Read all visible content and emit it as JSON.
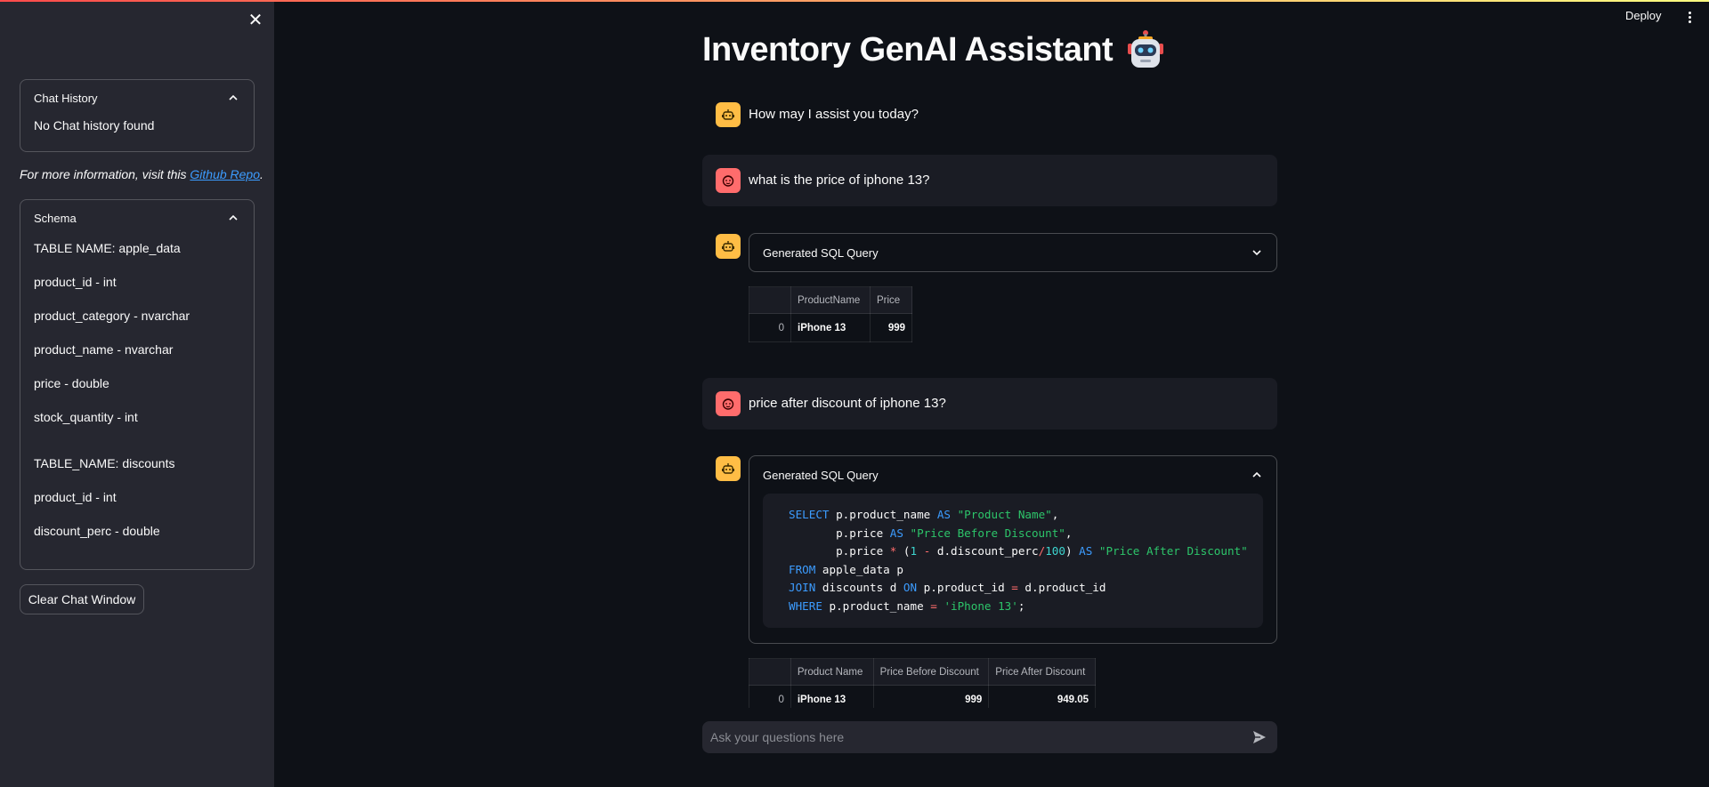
{
  "app": {
    "title": "Inventory GenAI Assistant"
  },
  "header": {
    "deploy_label": "Deploy"
  },
  "sidebar": {
    "chat_history": {
      "title": "Chat History",
      "empty_text": "No Chat history found"
    },
    "info": {
      "prefix": "For more information, visit this ",
      "link_text": "Github Repo",
      "suffix": "."
    },
    "schema": {
      "title": "Schema",
      "lines_a": [
        "TABLE NAME: apple_data",
        "product_id - int",
        "product_category - nvarchar",
        "product_name - nvarchar",
        "price - double",
        "stock_quantity - int"
      ],
      "lines_b": [
        "TABLE_NAME: discounts",
        "product_id - int",
        "discount_perc - double"
      ]
    },
    "clear_button": "Clear Chat Window"
  },
  "messages": {
    "greeting": "How may I assist you today?",
    "q1": "what is the price of iphone 13?",
    "q2": "price after discount of iphone 13?",
    "sql_expander_label": "Generated SQL Query"
  },
  "table1": {
    "columns": [
      "",
      "ProductName",
      "Price"
    ],
    "rows": [
      [
        "0",
        "iPhone 13",
        "999"
      ]
    ]
  },
  "table2": {
    "columns": [
      "",
      "Product Name",
      "Price Before Discount",
      "Price After Discount"
    ],
    "rows": [
      [
        "0",
        "iPhone 13",
        "999",
        "949.05"
      ]
    ]
  },
  "sql_code": [
    "SELECT p.product_name AS \"Product Name\",",
    "       p.price AS \"Price Before Discount\",",
    "       p.price * (1 - d.discount_perc/100) AS \"Price After Discount\"",
    "FROM apple_data p",
    "JOIN discounts d ON p.product_id = d.product_id",
    "WHERE p.product_name = 'iPhone 13';"
  ],
  "chat_input": {
    "placeholder": "Ask your questions here"
  },
  "colors": {
    "bot_avatar": "#ffbd45",
    "user_avatar": "#ff6c6c",
    "link": "#3c9cff",
    "keyword": "#3c9cff",
    "string": "#2dc56a"
  },
  "icons": [
    "close-icon",
    "chevron-up-icon",
    "chevron-down-icon",
    "robot-emoji-icon",
    "bot-avatar-icon",
    "user-avatar-icon",
    "send-icon",
    "kebab-menu-icon"
  ]
}
